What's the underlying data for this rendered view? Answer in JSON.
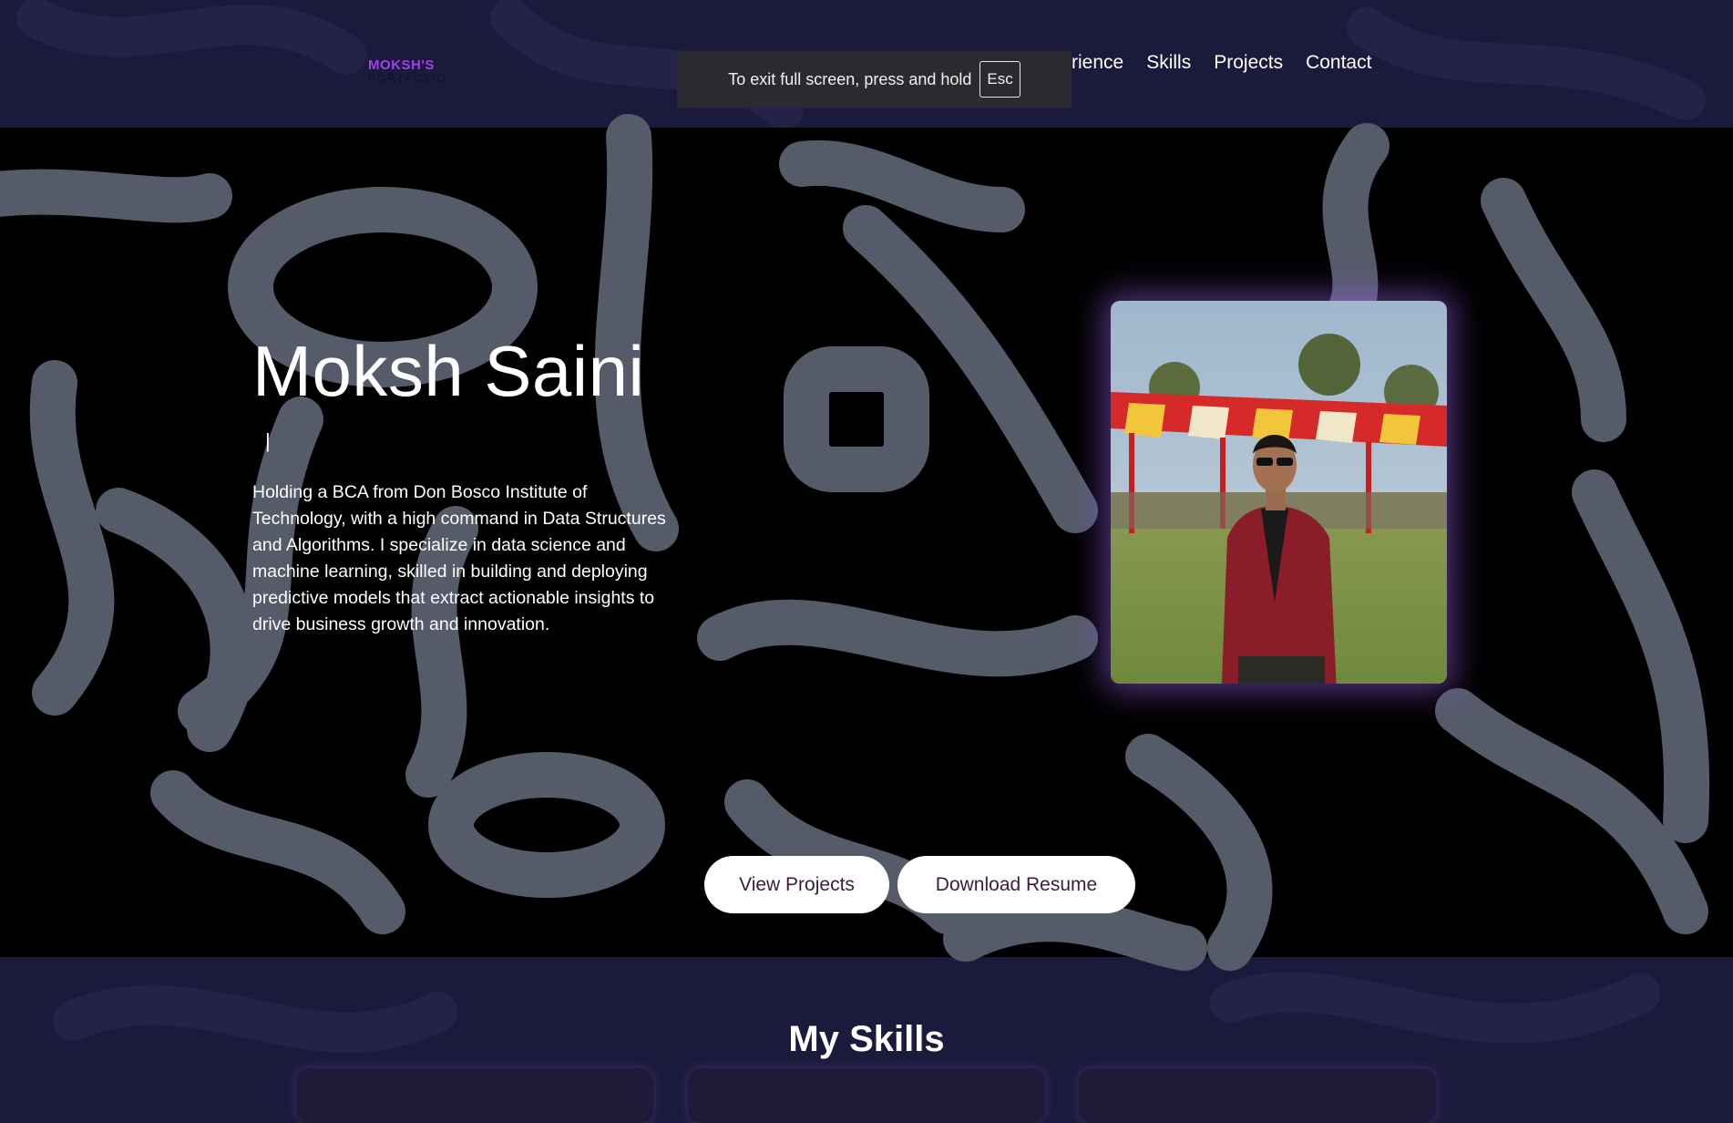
{
  "logo": {
    "line1": "MOKSH'S",
    "line2": "PORTFOLIO"
  },
  "nav": {
    "items": [
      "rience",
      "Skills",
      "Projects",
      "Contact"
    ]
  },
  "toast": {
    "text": "To exit full screen, press and hold",
    "key": "Esc"
  },
  "hero": {
    "name": "Moksh Saini",
    "typing_cursor": "|",
    "description": "Holding a BCA from Don Bosco Institute of Technology, with a high command in Data Structures and Algorithms. I specialize in data science and machine learning, skilled in building and deploying predictive models that extract actionable insights to drive business growth and innovation."
  },
  "buttons": {
    "view_projects": "View Projects",
    "download_resume": "Download Resume"
  },
  "skills": {
    "title": "My Skills"
  },
  "colors": {
    "page_bg": "#1c1a3c",
    "hero_bg": "#000000",
    "accent_purple": "#9d43e8",
    "button_text": "#3b1c3e"
  }
}
